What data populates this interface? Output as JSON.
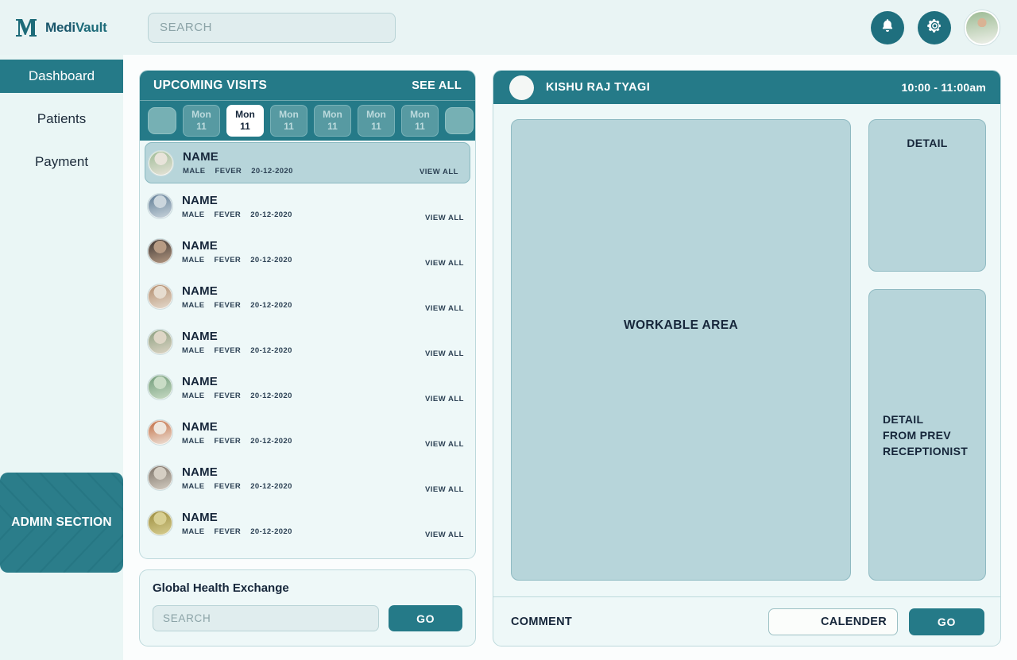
{
  "app": {
    "brand_prefix": "Medi",
    "brand_suffix": "Vault",
    "logo_icon": "m-monogram-icon",
    "accent_color": "#257a88",
    "panel_fill": "#b7d5da",
    "page_background": "#fbfdfd",
    "sidebar_background": "#eaf6f5"
  },
  "header": {
    "search_placeholder": "SEARCH",
    "search_value": "",
    "notifications_icon": "bell-icon",
    "settings_icon": "gear-icon",
    "avatar_icon": "user-avatar"
  },
  "sidebar": {
    "items": [
      {
        "label": "Dashboard",
        "active": true
      },
      {
        "label": "Patients",
        "active": false
      },
      {
        "label": "Payment",
        "active": false
      }
    ],
    "admin_card": {
      "label": "ADMIN SECTION"
    }
  },
  "visits": {
    "title": "UPCOMING VISITS",
    "see_all_label": "SEE ALL",
    "prev_icon": "prev-nav-button",
    "next_icon": "next-nav-button",
    "dates": [
      {
        "day": "Mon",
        "date": "11",
        "active": false
      },
      {
        "day": "Mon",
        "date": "11",
        "active": true
      },
      {
        "day": "Mon",
        "date": "11",
        "active": false
      },
      {
        "day": "Mon",
        "date": "11",
        "active": false
      },
      {
        "day": "Mon",
        "date": "11",
        "active": false
      },
      {
        "day": "Mon",
        "date": "11",
        "active": false
      }
    ],
    "view_all_label": "VIEW ALL",
    "rows": [
      {
        "name": "NAME",
        "gender": "MALE",
        "condition": "FEVER",
        "date": "20-12-2020",
        "selected": true,
        "avatar_color_a": "#9dbb95",
        "avatar_color_b": "#e8e4da"
      },
      {
        "name": "NAME",
        "gender": "MALE",
        "condition": "FEVER",
        "date": "20-12-2020",
        "selected": false,
        "avatar_color_a": "#5c7a93",
        "avatar_color_b": "#cbd6dd"
      },
      {
        "name": "NAME",
        "gender": "MALE",
        "condition": "FEVER",
        "date": "20-12-2020",
        "selected": false,
        "avatar_color_a": "#3a3330",
        "avatar_color_b": "#b79b84"
      },
      {
        "name": "NAME",
        "gender": "MALE",
        "condition": "FEVER",
        "date": "20-12-2020",
        "selected": false,
        "avatar_color_a": "#b08a6a",
        "avatar_color_b": "#e6dccf"
      },
      {
        "name": "NAME",
        "gender": "MALE",
        "condition": "FEVER",
        "date": "20-12-2020",
        "selected": false,
        "avatar_color_a": "#8a9e7f",
        "avatar_color_b": "#ded6c6"
      },
      {
        "name": "NAME",
        "gender": "MALE",
        "condition": "FEVER",
        "date": "20-12-2020",
        "selected": false,
        "avatar_color_a": "#6f9a78",
        "avatar_color_b": "#c9dcc6"
      },
      {
        "name": "NAME",
        "gender": "MALE",
        "condition": "FEVER",
        "date": "20-12-2020",
        "selected": false,
        "avatar_color_a": "#c06a3f",
        "avatar_color_b": "#efe6dd"
      },
      {
        "name": "NAME",
        "gender": "MALE",
        "condition": "FEVER",
        "date": "20-12-2020",
        "selected": false,
        "avatar_color_a": "#7b7166",
        "avatar_color_b": "#d5cec3"
      },
      {
        "name": "NAME",
        "gender": "MALE",
        "condition": "FEVER",
        "date": "20-12-2020",
        "selected": false,
        "avatar_color_a": "#9a8b3c",
        "avatar_color_b": "#d8cf92"
      }
    ]
  },
  "exchange": {
    "title": "Global Health Exchange",
    "search_placeholder": "SEARCH",
    "search_value": "",
    "go_label": "GO"
  },
  "workspace": {
    "patient_name": "KISHU RAJ TYAGI",
    "time_range": "10:00 - 11:00am",
    "avatar_icon": "patient-avatar-placeholder",
    "workable_label": "WORKABLE AREA",
    "detail_label": "DETAIL",
    "detail_prev_label": "DETAIL\nFROM PREV\nRECEPTIONIST",
    "detail_prev_lines": [
      "DETAIL",
      "FROM PREV",
      "RECEPTIONIST"
    ],
    "comment_label": "COMMENT",
    "calender_value": "CALENDER",
    "go_label": "GO"
  }
}
